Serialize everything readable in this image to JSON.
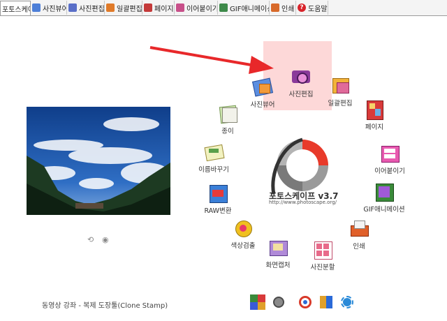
{
  "tabs": [
    {
      "label": "포토스케이프",
      "icon": "photoscape-icon",
      "color": "#ffffff"
    },
    {
      "label": "사진뷰어",
      "icon": "viewer-icon",
      "color": "#4d7fd8"
    },
    {
      "label": "사진편집",
      "icon": "editor-icon",
      "color": "#5a6fc8"
    },
    {
      "label": "일괄편집",
      "icon": "batch-icon",
      "color": "#e07b2a"
    },
    {
      "label": "페이지",
      "icon": "page-icon",
      "color": "#c43a3a"
    },
    {
      "label": "이어붙이기",
      "icon": "combine-icon",
      "color": "#c8508a"
    },
    {
      "label": "GIF애니메이션",
      "icon": "gif-icon",
      "color": "#3e8a4a"
    },
    {
      "label": "인쇄",
      "icon": "print-icon",
      "color": "#d86a2a"
    },
    {
      "label": "도움말",
      "icon": "help-icon",
      "color": "#d8232a"
    }
  ],
  "menu": {
    "viewer": "사진뷰어",
    "editor": "사진편집",
    "batch": "일괄편집",
    "paper": "종이",
    "page": "페이지",
    "rename": "이름바꾸기",
    "combine": "이어붙이기",
    "raw": "RAW변환",
    "gif": "GIF애니메이션",
    "color_picker": "색상검출",
    "print": "인쇄",
    "screen_capture": "화면캡처",
    "splitter": "사진분할"
  },
  "brand": {
    "name": "포토스케이프 v3.7",
    "url": "http://www.photoscape.org/"
  },
  "hint_text": "동영상 강좌 - 복제 도장툴(Clone Stamp)",
  "highlight_color": "#fdd8d8",
  "arrow_color": "#e8282a",
  "tools": [
    "language-icon",
    "settings-icon",
    "face-search-icon",
    "filter-icon",
    "brightness-icon"
  ]
}
